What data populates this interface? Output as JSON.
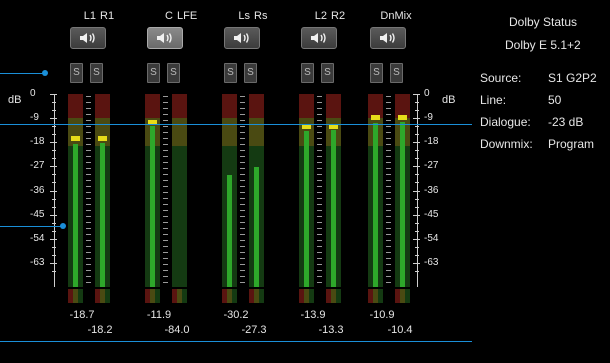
{
  "scale": {
    "unit": "dB",
    "ticks": [
      "0",
      "-9",
      "-18",
      "-27",
      "-36",
      "-45",
      "-54",
      "-63"
    ]
  },
  "pairs": [
    {
      "label_a": "L1",
      "label_b": "R1",
      "solo_a": "S",
      "solo_b": "S",
      "speaker_active": false,
      "readout_a": "-18.7",
      "readout_b": "-18.2",
      "level_a": -18.7,
      "level_b": -18.2,
      "peak_a": -18.0,
      "peak_b": -18.0
    },
    {
      "label_a": "C",
      "label_b": "LFE",
      "solo_a": "S",
      "solo_b": "S",
      "speaker_active": true,
      "readout_a": "-11.9",
      "readout_b": "-84.0",
      "level_a": -11.9,
      "level_b": -84.0,
      "peak_a": -12.0,
      "peak_b": null
    },
    {
      "label_a": "Ls",
      "label_b": "Rs",
      "solo_a": "S",
      "solo_b": "S",
      "speaker_active": false,
      "readout_a": "-30.2",
      "readout_b": "-27.3",
      "level_a": -30.2,
      "level_b": -27.3,
      "peak_a": null,
      "peak_b": null
    },
    {
      "label_a": "L2",
      "label_b": "R2",
      "solo_a": "S",
      "solo_b": "S",
      "speaker_active": false,
      "readout_a": "-13.9",
      "readout_b": "-13.3",
      "level_a": -13.9,
      "level_b": -13.3,
      "peak_a": -13.5,
      "peak_b": -13.5
    },
    {
      "label_a": "DnMix",
      "label_b": "",
      "solo_a": "S",
      "solo_b": "S",
      "speaker_active": false,
      "readout_a": "-10.9",
      "readout_b": "-10.4",
      "level_a": -10.9,
      "level_b": -10.4,
      "peak_a": -10.0,
      "peak_b": -10.0
    }
  ],
  "status": {
    "title": "Dolby Status",
    "format": "Dolby E 5.1+2",
    "rows": [
      {
        "key": "Source:",
        "value": "S1 G2P2"
      },
      {
        "key": "Line:",
        "value": "50"
      },
      {
        "key": "Dialogue:",
        "value": "-23 dB"
      },
      {
        "key": "Downmix:",
        "value": "Program"
      }
    ]
  },
  "colors": {
    "meter_green": "#2ea82a",
    "peak_yellow": "#e6dc19",
    "callout_blue": "#1a8fd8",
    "zone_red": "#5a1410",
    "zone_olive": "#4a4a12",
    "zone_green": "#143a12"
  }
}
